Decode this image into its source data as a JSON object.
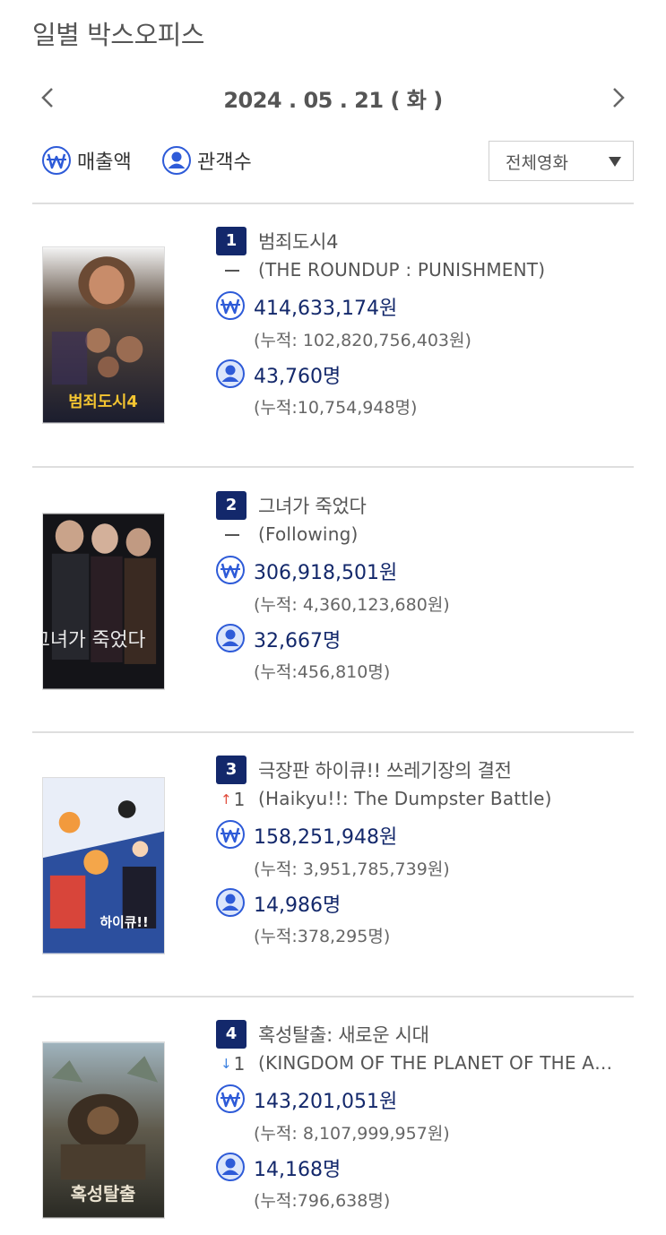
{
  "page": {
    "title": "일별 박스오피스",
    "date": "2024 . 05 . 21 ( 화 )"
  },
  "toggles": {
    "revenue_label": "매출액",
    "audience_label": "관객수"
  },
  "filter": {
    "selected": "전체영화"
  },
  "colors": {
    "accent": "#13286b",
    "icon": "#2e5bd8",
    "up": "#e04a3a",
    "down": "#3a7fe0"
  },
  "movies": [
    {
      "rank": "1",
      "title": "범죄도시4",
      "eng_title": "(THE ROUNDUP : PUNISHMENT)",
      "change_type": "none",
      "change": "",
      "revenue": "414,633,174원",
      "revenue_total": "(누적: 102,820,756,403원)",
      "audience": "43,760명",
      "audience_total": "(누적:10,754,948명)",
      "poster_text": "범죄도시4"
    },
    {
      "rank": "2",
      "title": "그녀가 죽었다",
      "eng_title": "(Following)",
      "change_type": "none",
      "change": "",
      "revenue": "306,918,501원",
      "revenue_total": "(누적: 4,360,123,680원)",
      "audience": "32,667명",
      "audience_total": "(누적:456,810명)",
      "poster_text": "그녀가 죽었다"
    },
    {
      "rank": "3",
      "title": "극장판 하이큐!! 쓰레기장의 결전",
      "eng_title": "(Haikyu!!: The Dumpster Battle)",
      "change_type": "up",
      "change": "1",
      "revenue": "158,251,948원",
      "revenue_total": "(누적: 3,951,785,739원)",
      "audience": "14,986명",
      "audience_total": "(누적:378,295명)",
      "poster_text": "하이큐!!"
    },
    {
      "rank": "4",
      "title": "혹성탈출: 새로운 시대",
      "eng_title": "(KINGDOM OF THE PLANET OF THE A…",
      "change_type": "down",
      "change": "1",
      "revenue": "143,201,051원",
      "revenue_total": "(누적: 8,107,999,957원)",
      "audience": "14,168명",
      "audience_total": "(누적:796,638명)",
      "poster_text": "혹성탈출"
    }
  ]
}
